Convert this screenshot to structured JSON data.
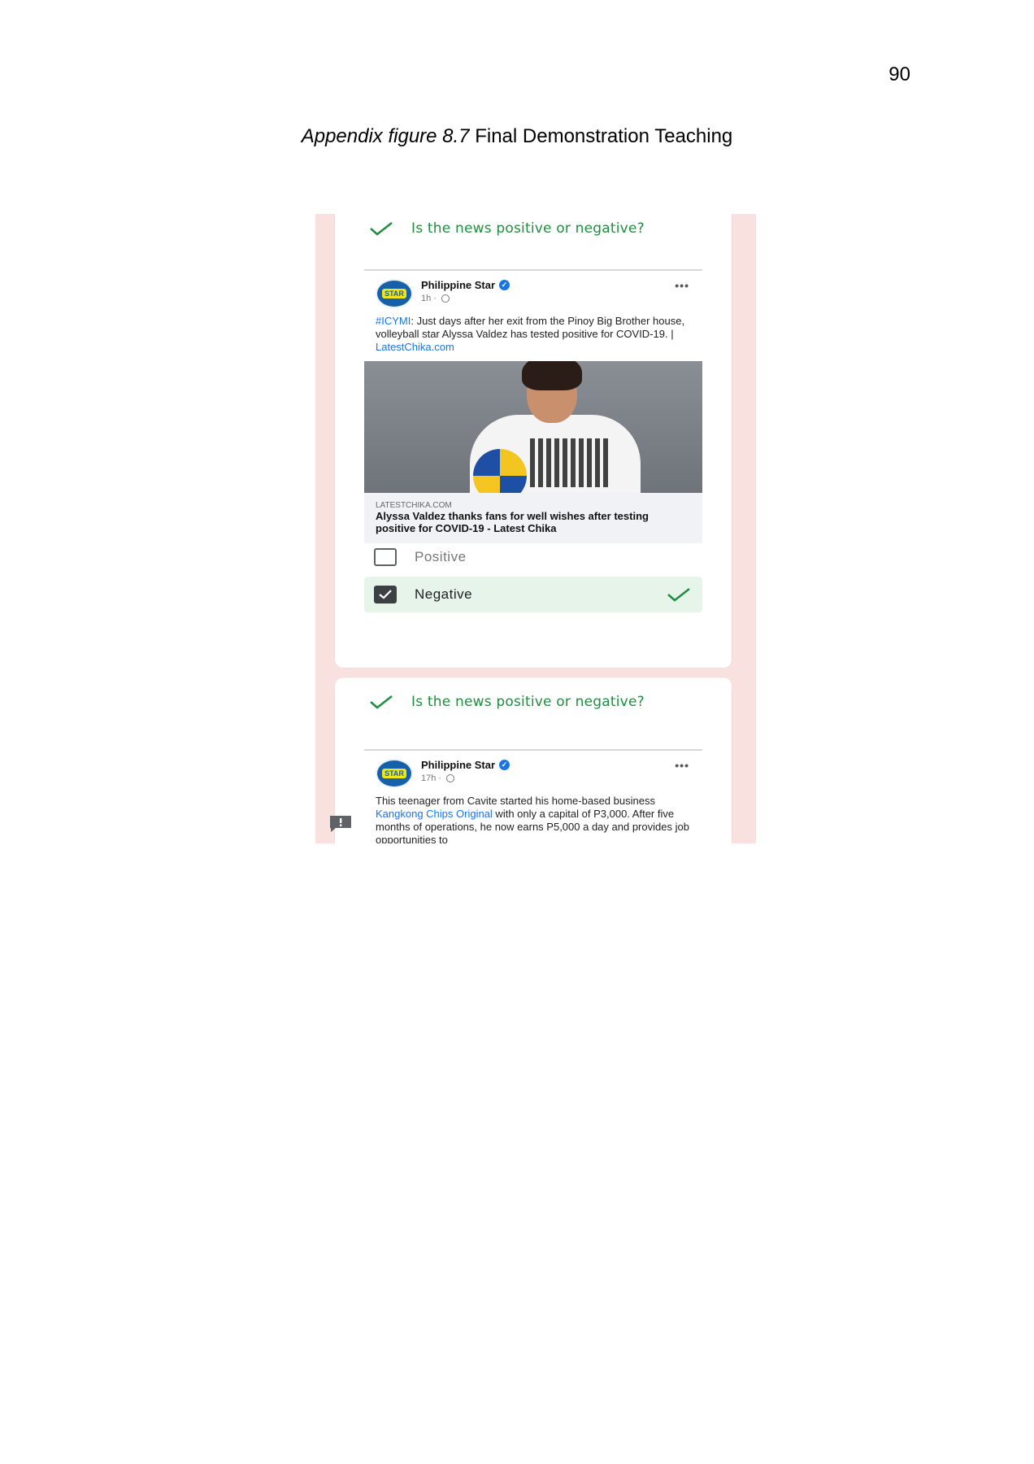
{
  "page_number": "90",
  "caption": {
    "label": "Appendix figure 8.7",
    "title": "Final Demonstration Teaching"
  },
  "screenshot": {
    "cards": [
      {
        "question": "Is the news positive or negative?",
        "post": {
          "page_name": "Philippine Star",
          "time": "1h ·",
          "avatar_text": "STAR",
          "text_hashtag": "#ICYMI",
          "text_body": ": Just days after her exit from the Pinoy Big Brother house, volleyball star Alyssa Valdez has tested positive for COVID-19.  | ",
          "text_link": "LatestChika.com",
          "preview_domain": "LATESTCHIKA.COM",
          "preview_title": "Alyssa Valdez thanks fans for well wishes after testing positive for COVID-19 - Latest Chika"
        },
        "options": [
          {
            "label": "Positive",
            "checked": false
          },
          {
            "label": "Negative",
            "checked": true
          }
        ]
      },
      {
        "question": "Is the news positive or negative?",
        "post": {
          "page_name": "Philippine Star",
          "time": "17h ·",
          "avatar_text": "STAR",
          "text_part1": "This teenager from Cavite started his home-based business ",
          "text_link": "Kangkong Chips Original",
          "text_part2": " with only a capital of P3,000. After five months of operations, he now earns P5,000 a day and provides job opportunities to"
        }
      }
    ]
  }
}
